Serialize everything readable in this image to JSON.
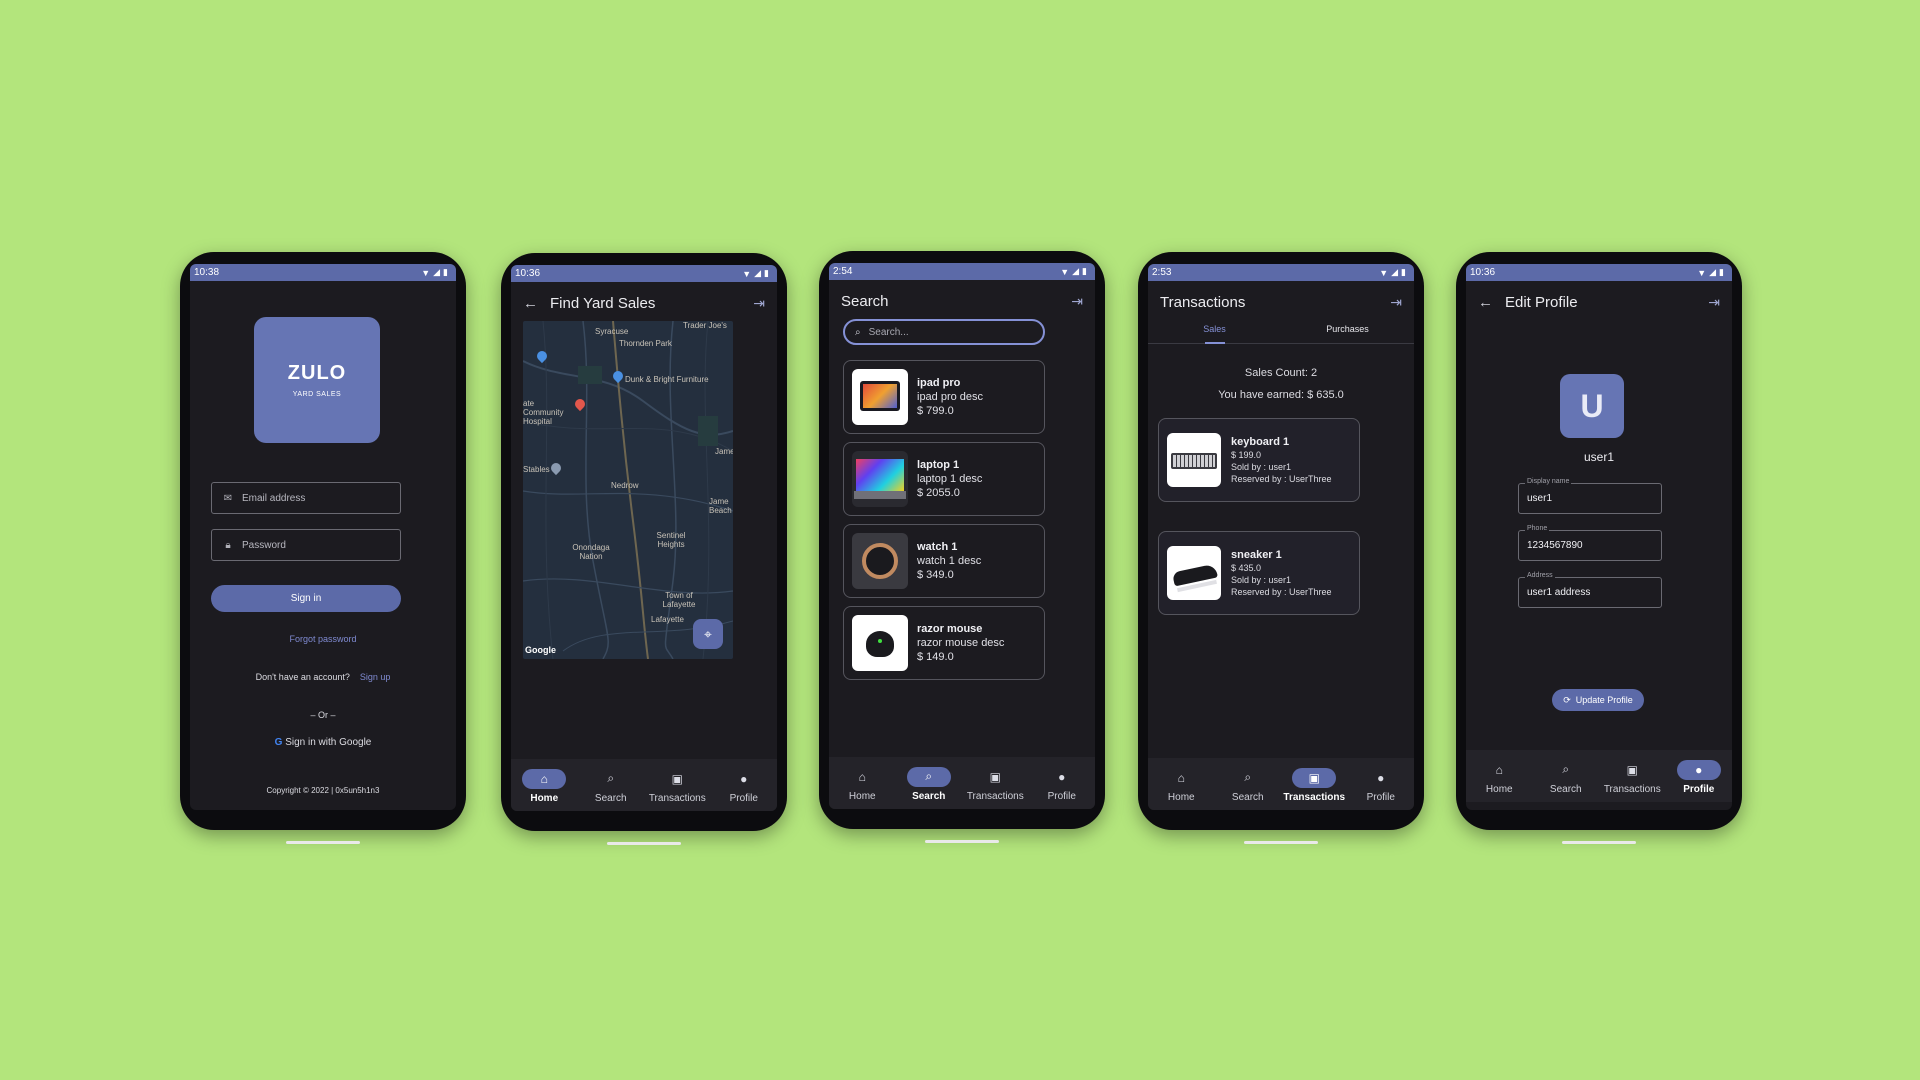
{
  "status": {
    "screen1_time": "10:38",
    "screen2_time": "10:36",
    "screen3_time": "2:54",
    "screen4_time": "2:53",
    "screen5_time": "10:36"
  },
  "nav": {
    "home": "Home",
    "search": "Search",
    "transactions": "Transactions",
    "profile": "Profile"
  },
  "login": {
    "logo_title": "ZULO",
    "logo_sub": "YARD SALES",
    "email_placeholder": "Email address",
    "password_placeholder": "Password",
    "sign_in": "Sign in",
    "forgot_password": "Forgot password",
    "no_account": "Don't have an account?",
    "sign_up": "Sign up",
    "or": "– Or –",
    "google_sign_in": "Sign in with Google",
    "copyright": "Copyright © 2022 | 0x5un5h1n3"
  },
  "map_screen": {
    "title": "Find Yard Sales",
    "labels": [
      "Syracuse",
      "Thornden Park",
      "Dunk & Bright Furniture",
      "Trader Joe's",
      "ate Community Hospital",
      "Stables",
      "Nedrow",
      "Onondaga Nation",
      "Sentinel Heights",
      "Town of Lafayette",
      "Lafayette",
      "Jame",
      "Jame Beach"
    ],
    "google": "Google"
  },
  "search_screen": {
    "title": "Search",
    "placeholder": "Search...",
    "items": [
      {
        "name": "ipad pro",
        "desc": "ipad pro desc",
        "price": "$ 799.0"
      },
      {
        "name": "laptop 1",
        "desc": "laptop 1 desc",
        "price": "$ 2055.0"
      },
      {
        "name": "watch 1",
        "desc": "watch 1 desc",
        "price": "$ 349.0"
      },
      {
        "name": "razor mouse",
        "desc": "razor mouse desc",
        "price": "$ 149.0"
      }
    ]
  },
  "transactions_screen": {
    "title": "Transactions",
    "tab_sales": "Sales",
    "tab_purchases": "Purchases",
    "sales_count": "Sales Count: 2",
    "earned": "You have earned: $ 635.0",
    "items": [
      {
        "name": "keyboard 1",
        "price": "$ 199.0",
        "sold_by": "Sold by : user1",
        "reserved_by": "Reserved by : UserThree"
      },
      {
        "name": "sneaker 1",
        "price": "$ 435.0",
        "sold_by": "Sold by : user1",
        "reserved_by": "Reserved by : UserThree"
      }
    ]
  },
  "profile_screen": {
    "title": "Edit Profile",
    "avatar_letter": "U",
    "username": "user1",
    "display_name_label": "Display name",
    "display_name_value": "user1",
    "phone_label": "Phone",
    "phone_value": "1234567890",
    "address_label": "Address",
    "address_value": "user1 address",
    "update_button": "Update Profile"
  },
  "colors": {
    "background": "#b3e57c",
    "accent": "#5c6aa8",
    "screen_bg": "#1c1b20"
  }
}
